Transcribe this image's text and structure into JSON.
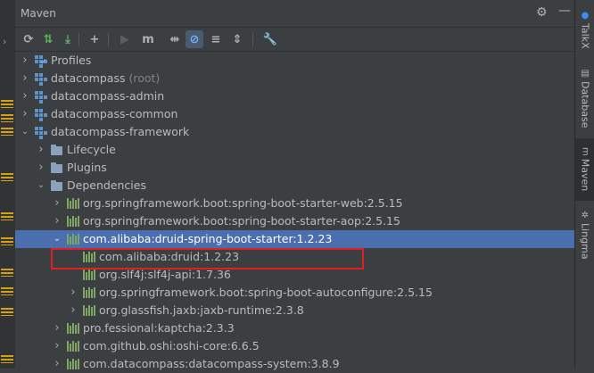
{
  "panel": {
    "title": "Maven",
    "title_icons": [
      "gear-icon",
      "minimize-icon"
    ]
  },
  "toolbar": {
    "buttons": [
      {
        "name": "reload-icon",
        "glyph": "⟳"
      },
      {
        "name": "generate-sources-icon",
        "glyph": "⇅"
      },
      {
        "name": "download-icon",
        "glyph": "⤓"
      },
      {
        "name": "add-icon",
        "glyph": "+"
      },
      {
        "name": "run-icon",
        "glyph": "▶"
      },
      {
        "name": "maven-goal-icon",
        "glyph": "m"
      },
      {
        "name": "toggle-offline-icon",
        "glyph": "⇹"
      },
      {
        "name": "skip-tests-icon",
        "glyph": "⊘"
      },
      {
        "name": "show-dependencies-icon",
        "glyph": "≡"
      },
      {
        "name": "collapse-all-icon",
        "glyph": "⇕"
      },
      {
        "name": "settings-wrench-icon",
        "glyph": "🔧"
      }
    ]
  },
  "tree": [
    {
      "label": "Profiles",
      "suffix": "",
      "level": 0,
      "expanded": false,
      "icon": "profiles"
    },
    {
      "label": "datacompass",
      "suffix": " (root)",
      "level": 0,
      "expanded": false,
      "icon": "module"
    },
    {
      "label": "datacompass-admin",
      "suffix": "",
      "level": 0,
      "expanded": false,
      "icon": "module"
    },
    {
      "label": "datacompass-common",
      "suffix": "",
      "level": 0,
      "expanded": false,
      "icon": "module"
    },
    {
      "label": "datacompass-framework",
      "suffix": "",
      "level": 0,
      "expanded": true,
      "icon": "module"
    },
    {
      "label": "Lifecycle",
      "suffix": "",
      "level": 1,
      "expanded": false,
      "icon": "folder"
    },
    {
      "label": "Plugins",
      "suffix": "",
      "level": 1,
      "expanded": false,
      "icon": "folder"
    },
    {
      "label": "Dependencies",
      "suffix": "",
      "level": 1,
      "expanded": true,
      "icon": "folder"
    },
    {
      "label": "org.springframework.boot:spring-boot-starter-web:2.5.15",
      "suffix": "",
      "level": 2,
      "expanded": false,
      "icon": "lib"
    },
    {
      "label": "org.springframework.boot:spring-boot-starter-aop:2.5.15",
      "suffix": "",
      "level": 2,
      "expanded": false,
      "icon": "lib"
    },
    {
      "label": "com.alibaba:druid-spring-boot-starter:1.2.23",
      "suffix": "",
      "level": 2,
      "expanded": true,
      "icon": "lib",
      "selected": true
    },
    {
      "label": "com.alibaba:druid:1.2.23",
      "suffix": "",
      "level": 3,
      "leaf": true,
      "icon": "lib"
    },
    {
      "label": "org.slf4j:slf4j-api:1.7.36",
      "suffix": "",
      "level": 3,
      "leaf": true,
      "icon": "lib"
    },
    {
      "label": "org.springframework.boot:spring-boot-autoconfigure:2.5.15",
      "suffix": "",
      "level": 3,
      "expanded": false,
      "icon": "lib"
    },
    {
      "label": "org.glassfish.jaxb:jaxb-runtime:2.3.8",
      "suffix": "",
      "level": 3,
      "expanded": false,
      "icon": "lib"
    },
    {
      "label": "pro.fessional:kaptcha:2.3.3",
      "suffix": "",
      "level": 2,
      "expanded": false,
      "icon": "lib"
    },
    {
      "label": "com.github.oshi:oshi-core:6.6.5",
      "suffix": "",
      "level": 2,
      "expanded": false,
      "icon": "lib"
    },
    {
      "label": "com.datacompass:datacompass-system:3.8.9",
      "suffix": "",
      "level": 2,
      "expanded": false,
      "icon": "lib"
    }
  ],
  "sidebar": {
    "tabs": [
      {
        "label": "TalkX",
        "icon": "talkx-icon"
      },
      {
        "label": "Database",
        "icon": "database-icon"
      },
      {
        "label": "Maven",
        "icon": "maven-icon",
        "active": true
      },
      {
        "label": "Lingma",
        "icon": "lingma-icon"
      }
    ]
  },
  "colors": {
    "background": "#3c3f41",
    "selection": "#4b6eaf",
    "highlight_box": "#e02020",
    "library_icon": "#7fa563",
    "module_icon": "#5e93c9"
  }
}
